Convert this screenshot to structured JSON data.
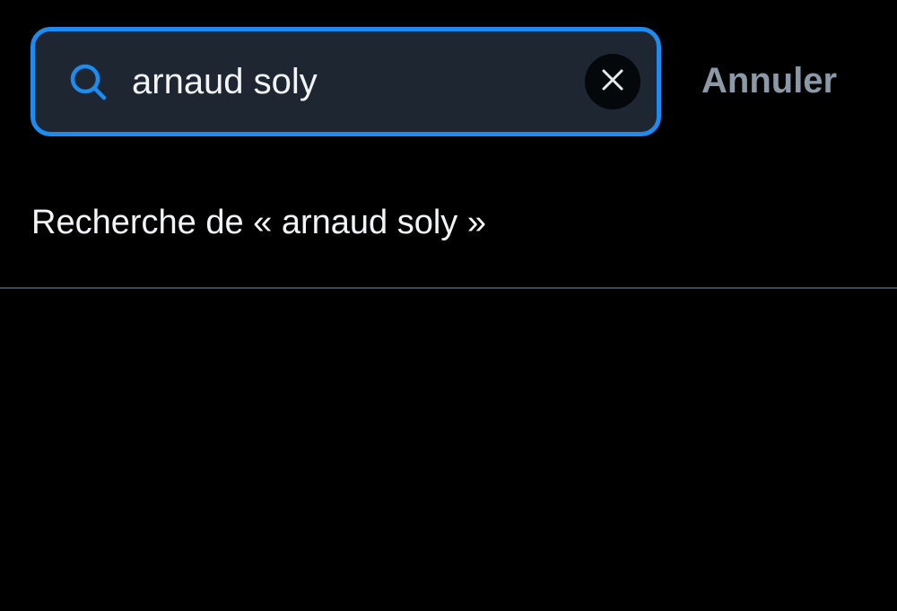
{
  "search": {
    "value": "arnaud soly",
    "icon": "search-icon",
    "clear_icon": "close-icon"
  },
  "header": {
    "cancel_label": "Annuler"
  },
  "suggestion": {
    "label": "Recherche de « arnaud soly »"
  },
  "colors": {
    "background": "#000000",
    "accent": "#1d8cf0",
    "field_background": "#1e2731",
    "text_primary": "#f2f4f6",
    "text_secondary": "#8b98a5",
    "divider": "#3b4754"
  }
}
